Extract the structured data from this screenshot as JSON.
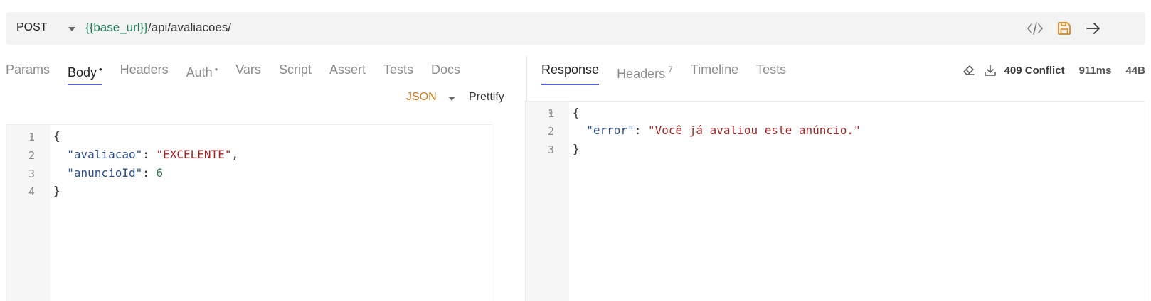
{
  "request": {
    "method": "POST",
    "url_var": "{{base_url}}",
    "url_path": "/api/avaliacoes/"
  },
  "toolbar_icons": [
    "code-icon",
    "save-icon",
    "send-arrow-icon"
  ],
  "request_tabs": [
    {
      "label": "Params",
      "active": false,
      "marker": ""
    },
    {
      "label": "Body",
      "active": true,
      "marker": "•"
    },
    {
      "label": "Headers",
      "active": false,
      "marker": ""
    },
    {
      "label": "Auth",
      "active": false,
      "marker": "•"
    },
    {
      "label": "Vars",
      "active": false,
      "marker": ""
    },
    {
      "label": "Script",
      "active": false,
      "marker": ""
    },
    {
      "label": "Assert",
      "active": false,
      "marker": ""
    },
    {
      "label": "Tests",
      "active": false,
      "marker": ""
    },
    {
      "label": "Docs",
      "active": false,
      "marker": ""
    }
  ],
  "body_mode": {
    "type": "JSON",
    "prettify": "Prettify"
  },
  "request_body": {
    "line_numbers": [
      "1",
      "2",
      "3",
      "4"
    ],
    "lines": {
      "l1": "{",
      "l2_key": "\"avaliacao\"",
      "l2_value": "\"EXCELENTE\"",
      "l3_key": "\"anuncioId\"",
      "l3_value": "6",
      "l4": "}"
    }
  },
  "response_tabs": [
    {
      "label": "Response",
      "active": true,
      "sup": ""
    },
    {
      "label": "Headers",
      "active": false,
      "sup": "7"
    },
    {
      "label": "Timeline",
      "active": false,
      "sup": ""
    },
    {
      "label": "Tests",
      "active": false,
      "sup": ""
    }
  ],
  "response_meta": {
    "status": "409 Conflict",
    "time": "911ms",
    "size": "44B"
  },
  "response_body": {
    "line_numbers": [
      "1",
      "2",
      "3"
    ],
    "lines": {
      "l1": "{",
      "l2_key": "\"error\"",
      "l2_value": "\"Você já avaliou este anúncio.\"",
      "l3": "}"
    }
  },
  "colors": {
    "accent": "#5b63d6",
    "json_mode": "#cc7a1f",
    "url_var": "#1f7a55",
    "json_key": "#2c4d8c",
    "json_string": "#a12525",
    "save_icon": "#d9891f"
  }
}
